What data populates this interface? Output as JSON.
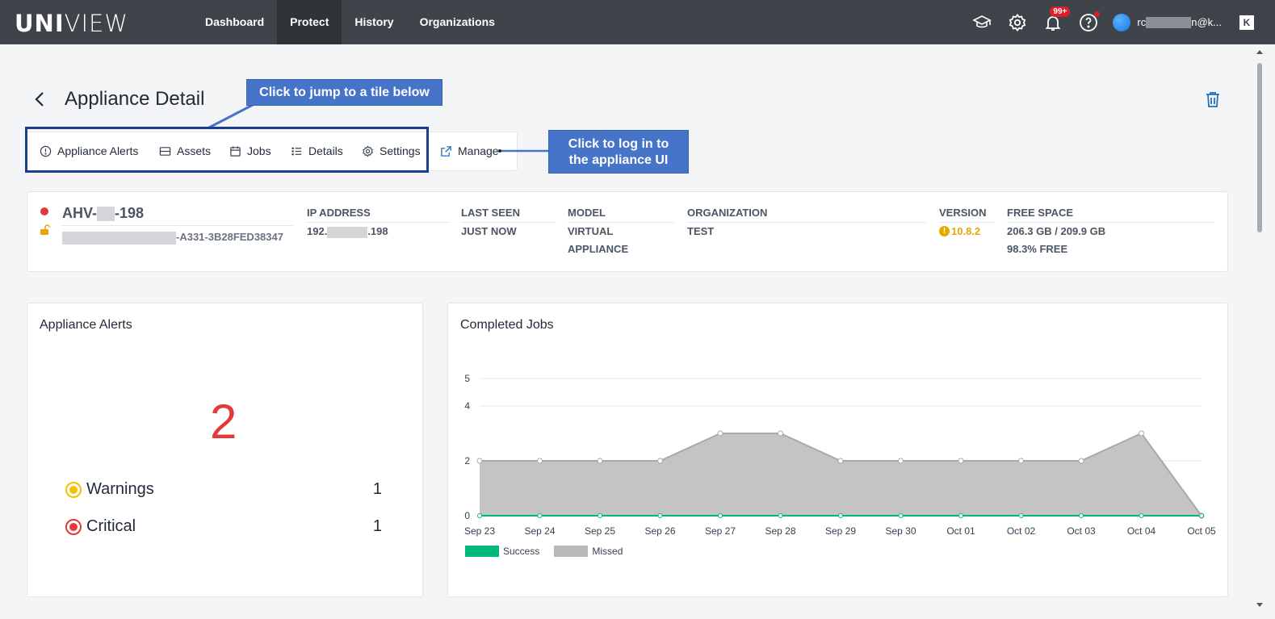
{
  "app": {
    "logo_bold": "UNI",
    "logo_light": "VIEW"
  },
  "nav": {
    "items": [
      "Dashboard",
      "Protect",
      "History",
      "Organizations"
    ],
    "active": "Protect"
  },
  "topbar": {
    "badge": "99+",
    "user_prefix": "rc",
    "user_suffix": "n@k...",
    "k_label": "K"
  },
  "header": {
    "title": "Appliance Detail"
  },
  "tabs": [
    "Appliance Alerts",
    "Assets",
    "Jobs",
    "Details",
    "Settings"
  ],
  "manage_label": "Manage",
  "callouts": {
    "tiles": "Click to jump to a tile below",
    "manage_line1": "Click to log in to",
    "manage_line2": "the appliance UI"
  },
  "appliance": {
    "name_prefix": "AHV-",
    "name_suffix": "-198",
    "id_suffix": "-A331-3B28FED38347",
    "ip_label": "IP ADDRESS",
    "ip_prefix": "192.",
    "ip_suffix": ".198",
    "seen_label": "LAST SEEN",
    "seen_value": "JUST NOW",
    "model_label": "MODEL",
    "model_line1": "VIRTUAL",
    "model_line2": "APPLIANCE",
    "org_label": "ORGANIZATION",
    "org_value": "TEST",
    "version_label": "VERSION",
    "version_value": "10.8.2",
    "version_icon": "!",
    "space_label": "FREE SPACE",
    "space_value": "206.3 GB / 209.9 GB",
    "space_free": "98.3% FREE",
    "status_color": "#e5383b"
  },
  "alerts": {
    "title": "Appliance Alerts",
    "total": "2",
    "rows": [
      {
        "label": "Warnings",
        "count": "1",
        "color": "#f2c200"
      },
      {
        "label": "Critical",
        "count": "1",
        "color": "#e53939"
      }
    ]
  },
  "jobs": {
    "title": "Completed Jobs"
  },
  "chart_data": {
    "type": "area",
    "title": "Completed Jobs",
    "categories": [
      "Sep 23",
      "Sep 24",
      "Sep 25",
      "Sep 26",
      "Sep 27",
      "Sep 28",
      "Sep 29",
      "Sep 30",
      "Oct 01",
      "Oct 02",
      "Oct 03",
      "Oct 04",
      "Oct 05"
    ],
    "yticks": [
      0,
      2,
      4,
      5
    ],
    "ylim": [
      0,
      5
    ],
    "series": [
      {
        "name": "Success",
        "color": "#00b87a",
        "values": [
          0,
          0,
          0,
          0,
          0,
          0,
          0,
          0,
          0,
          0,
          0,
          0,
          0
        ]
      },
      {
        "name": "Missed",
        "color": "#bdbdbd",
        "values": [
          2,
          2,
          2,
          2,
          3,
          3,
          2,
          2,
          2,
          2,
          2,
          3,
          0
        ]
      }
    ],
    "legend": "bottom-left"
  }
}
